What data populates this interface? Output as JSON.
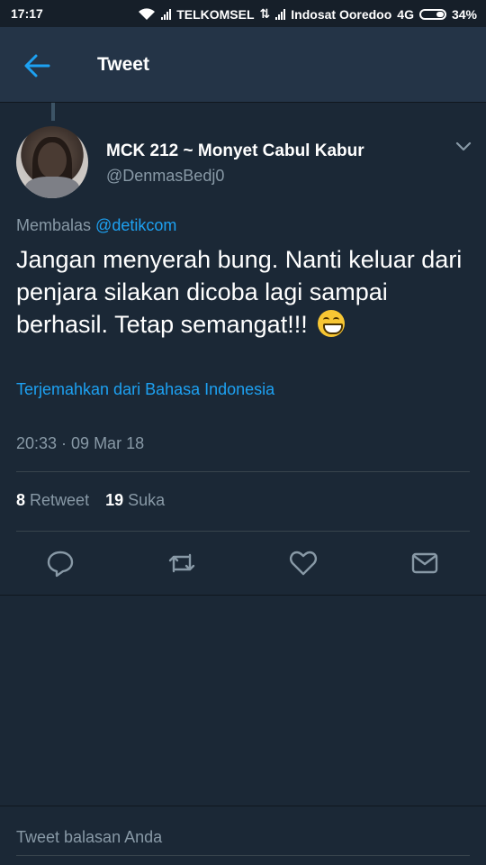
{
  "status_bar": {
    "time": "17:17",
    "carrier1": "TELKOMSEL",
    "carrier2": "Indosat Ooredoo",
    "network": "4G",
    "battery": "34%"
  },
  "app_bar": {
    "title": "Tweet"
  },
  "tweet": {
    "author_name": "MCK 212 ~ Monyet Cabul Kabur",
    "author_handle": "@DenmasBedj0",
    "reply_prefix": "Membalas",
    "reply_to": "@detikcom",
    "text": "Jangan menyerah bung. Nanti keluar dari penjara silakan dicoba lagi sampai berhasil. Tetap semangat!!!",
    "emoji": "grinning-face",
    "translate_link": "Terjemahkan dari Bahasa Indonesia",
    "timestamp": "20:33 · 09 Mar 18",
    "retweet_count": "8",
    "retweet_label": "Retweet",
    "like_count": "19",
    "like_label": "Suka"
  },
  "actions": [
    "reply-icon",
    "retweet-icon",
    "like-icon",
    "message-icon"
  ],
  "composer": {
    "placeholder": "Tweet balasan Anda"
  },
  "colors": {
    "background": "#1b2836",
    "app_bar": "#243447",
    "accent": "#1da1f2",
    "secondary_text": "#8899a6"
  }
}
